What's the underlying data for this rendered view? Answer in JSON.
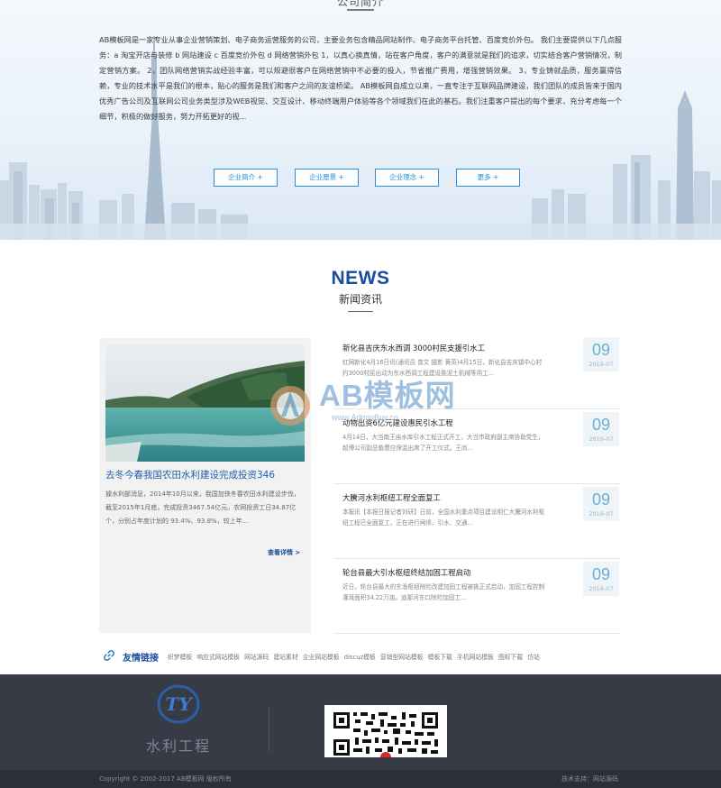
{
  "about": {
    "title": "公司简介",
    "text": "AB模板网是一家专业从事企业营销策划、电子商务运营服务的公司，主要业务包含精品网站制作、电子商务平台托管、百度竞价外包。 我们主要提供以下几点服务：a 淘宝开店与装修 b 网站建设 c 百度竞价外包 d 网络营销外包 1，以真心换真情，站在客户角度，客户的满意就是我们的追求，切实结合客户营销情况，制定营销方案。 2，团队网络营销实战经验丰富，可以规避很客户在网络营销中不必要的投入，节省推广费用，增强营销效果。 3，专业铸就品质，服务赢得信赖，专业的技术水平是我们的根本，贴心的服务是我们和客户之间的友谊桥梁。 AB模板网自成立以来，一直专注于互联网品牌建设，我们团队的成员皆来于国内优秀广告公司及互联网公司业务类型涉及WEB视觉、交互设计、移动终端用户体验等各个领域我们在此的基石。我们注重客户提出的每个要求，充分考虑每一个细节，积极的做好服务，努力开拓更好的视...",
    "buttons": [
      "企业简介 +",
      "企业愿景 +",
      "企业理念 +",
      "更多 +"
    ]
  },
  "news": {
    "title": "NEWS",
    "subtitle": "新闻资讯",
    "featured": {
      "title": "去冬今春我国农田水利建设完成投资346",
      "desc": "據水利部消息，2014年10月以来，我国加快冬春农田水利建设步伐，截至2015年1月底，完成投资3467.54亿元。农网投资工日34.87亿个，分别占年度计划的 93.4%、93.8%，较上年...",
      "more": "查看详情 >"
    },
    "items": [
      {
        "title": "新化县吉庆东水西调 3000村民支援引水工",
        "desc": "红网新化4月16日讯(通讯员 曾文 摄影 黄英)4月15日，新化县吉庆镇中心村约3000村民出动为东水西调工程建设挑泥土机械等用工...",
        "day": "09",
        "ym": "2016-07"
      },
      {
        "title": "动物出资6亿元建设惠民引水工程",
        "desc": "4月14日，大当南王庙水库引水工程正式开工，大当市政府副主席协助党生，超博公司副总裁曹应保监出席了开工仪式。王尚...",
        "day": "09",
        "ym": "2016-07"
      },
      {
        "title": "大騰河水利枢纽工程全面复工",
        "desc": "本报讯【本报日报记者刘研】日前，全国水利重点项目建设相仁大騰河水利枢纽工程已全面复工，正在进行闸坝、引水、交通...",
        "day": "09",
        "ym": "2016-07"
      },
      {
        "title": "轮台县最大引水枢纽终结加固工程启动",
        "desc": "近日，轮台县最大的东渔枢纽除险改建加固工程被挑正式启动，加固工程控制灌溉面积34.22万亩。迪那河东口除险加固工...",
        "day": "09",
        "ym": "2016-07"
      }
    ]
  },
  "watermark": {
    "text": "AB模板网",
    "url": "www.AdminBuy.cn"
  },
  "links": {
    "label": "友情链接",
    "items": [
      "织梦模板",
      "响应式网站模板",
      "网站源码",
      "建站素材",
      "企业网站模板",
      "discuz模板",
      "营销型网站模板",
      "模板下载",
      "手机网站模板",
      "图标下载",
      "仿站"
    ]
  },
  "footer": {
    "logo_mark": "TY",
    "logo_text": "水利工程",
    "copyright": "Copyright © 2002-2017 AB模板网 版权所有",
    "support": "技术支持：网站源码"
  }
}
